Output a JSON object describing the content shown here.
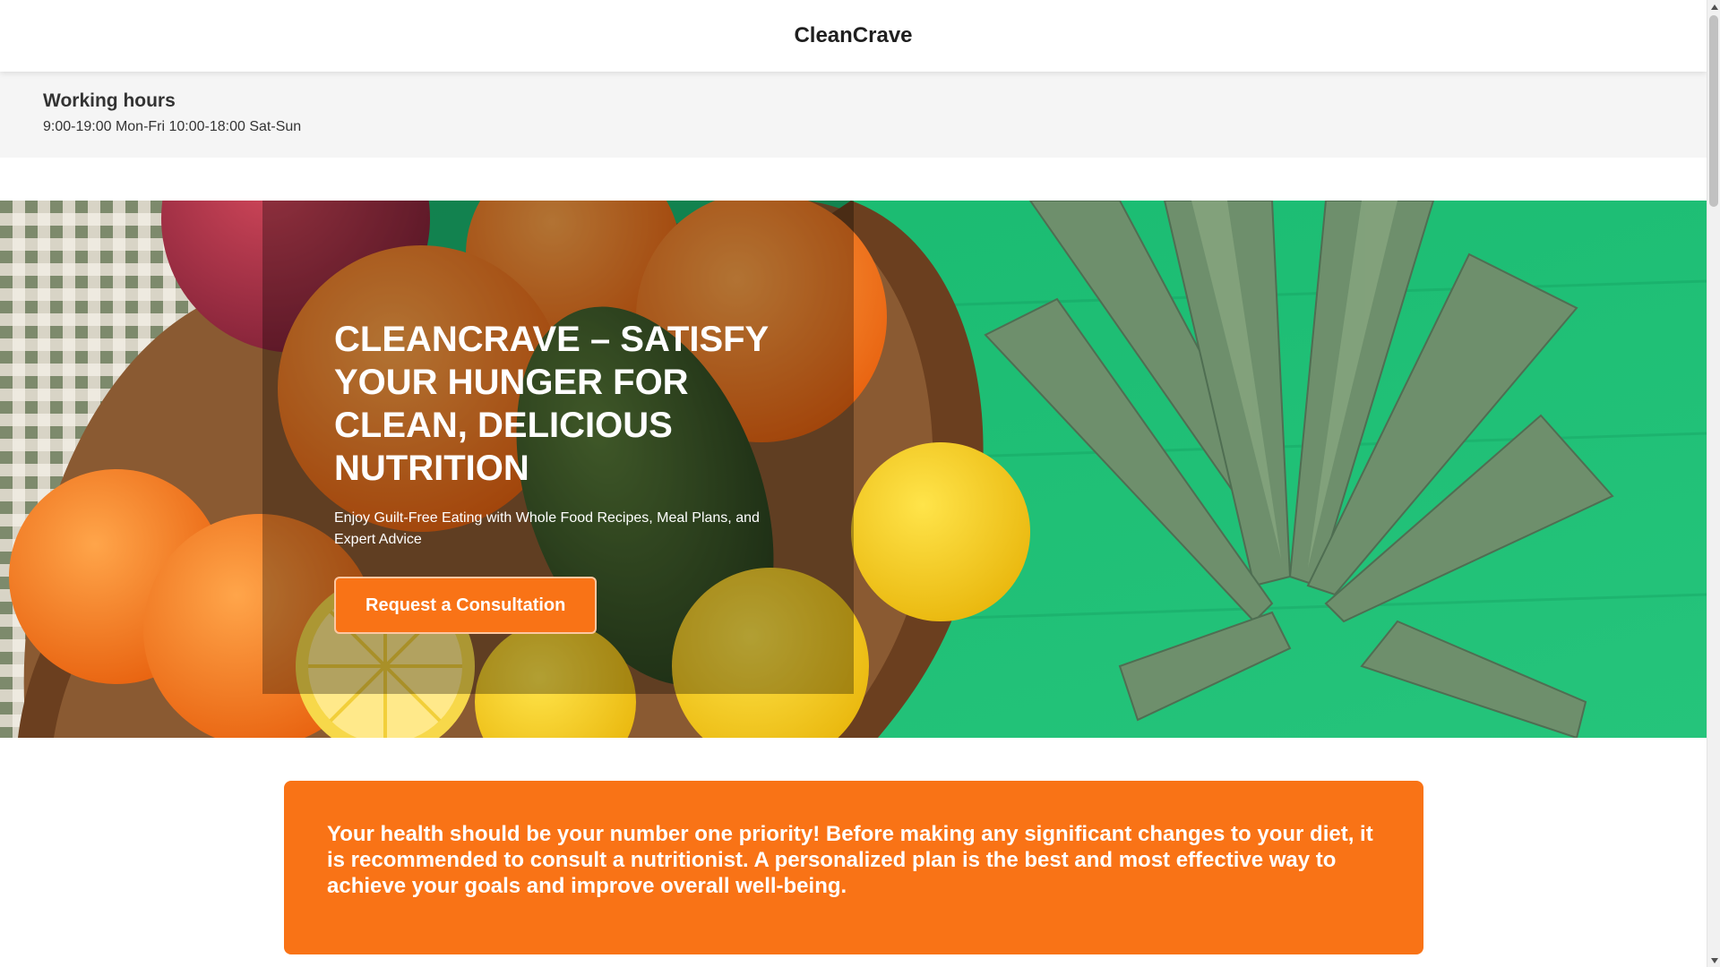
{
  "header": {
    "brand": "CleanCrave"
  },
  "working_hours": {
    "title": "Working hours",
    "text": "9:00-19:00 Mon-Fri 10:00-18:00 Sat-Sun"
  },
  "hero": {
    "title": "CLEANCRAVE – SATISFY YOUR HUNGER FOR CLEAN, DELICIOUS NUTRITION",
    "subtitle": "Enjoy Guilt-Free Eating with Whole Food Recipes, Meal Plans, and Expert Advice",
    "cta_label": "Request a Consultation",
    "image": "fruit-basket-hero-image"
  },
  "notice": {
    "text": "Your health should be your number one priority! Before making any significant changes to your diet, it is recommended to consult a nutritionist. A personalized plan is the best and most effective way to achieve your goals and improve overall well-being."
  },
  "colors": {
    "accent": "#f97316",
    "hero_green": "#1fbf73",
    "text_dark": "#333333"
  }
}
